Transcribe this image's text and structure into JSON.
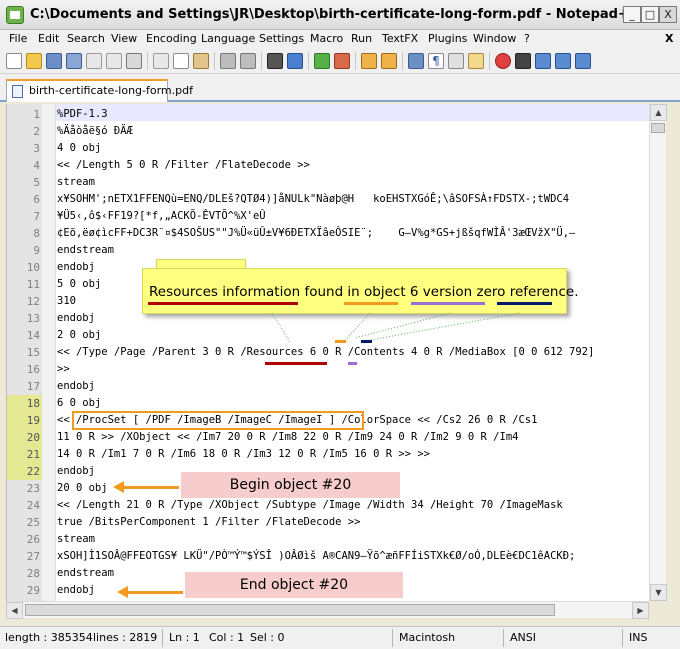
{
  "window": {
    "title": "C:\\Documents and Settings\\JR\\Desktop\\birth-certificate-long-form.pdf - Notepad++",
    "minimize": "_",
    "maximize": "□",
    "close": "X"
  },
  "menu": [
    "File",
    "Edit",
    "Search",
    "View",
    "Encoding",
    "Language",
    "Settings",
    "Macro",
    "Run",
    "TextFX",
    "Plugins",
    "Window",
    "?"
  ],
  "menu_close": "X",
  "tab": {
    "label": "birth-certificate-long-form.pdf"
  },
  "lines": [
    {
      "n": "1",
      "t": "%PDF-1.3"
    },
    {
      "n": "2",
      "t": "%Äåòåë§ó ÐÄÆ"
    },
    {
      "n": "3",
      "t": "4 0 obj"
    },
    {
      "n": "4",
      "t": "<< /Length 5 0 R /Filter /FlateDecode >>"
    },
    {
      "n": "5",
      "t": "stream"
    },
    {
      "n": "6",
      "t": "x¥SOHM';nETX1FFENQù=ENQ/DLEš?QTØ4)]åNULk\"Nàøþ@H   koEHSTXGóÊ;\\âSOFSÀ↑FDSTX-;tWDC4"
    },
    {
      "n": "7",
      "t": "¥Ü5‹,ô$‹FF19?[*f,„ACKÕ-ÊVTÕ^%X'eÛ"
    },
    {
      "n": "8",
      "t": "¢Eõ,ëø¢ìcFF+DC3R¨¤$4SOŠUS\"\"J%Ü«üÛ±V¥6ÐETXÏâeÔSIE¨;    G—V%g*GS+jßšqfWÌÂ'3æŒVžX\"Ü,—"
    },
    {
      "n": "9",
      "t": "endstream"
    },
    {
      "n": "10",
      "t": "endobj"
    },
    {
      "n": "11",
      "t": "5 0 obj"
    },
    {
      "n": "12",
      "t": "310"
    },
    {
      "n": "13",
      "t": "endobj"
    },
    {
      "n": "14",
      "t": "2 0 obj"
    },
    {
      "n": "15",
      "t": "<< /Type /Page /Parent 3 0 R /Resources 6 0 R /Contents 4 0 R /MediaBox [0 0 612 792]"
    },
    {
      "n": "16",
      "t": ">>"
    },
    {
      "n": "17",
      "t": "endobj"
    },
    {
      "n": "18",
      "t": "6 0 obj"
    },
    {
      "n": "19",
      "t": "<< /ProcSet [ /PDF /ImageB /ImageC /ImageI ] /ColorSpace << /Cs2 26 0 R /Cs1"
    },
    {
      "n": "20",
      "t": "11 0 R >> /XObject << /Im7 20 0 R /Im8 22 0 R /Im9 24 0 R /Im2 9 0 R /Im4"
    },
    {
      "n": "21",
      "t": "14 0 R /Im1 7 0 R /Im6 18 0 R /Im3 12 0 R /Im5 16 0 R >> >>"
    },
    {
      "n": "22",
      "t": "endobj"
    },
    {
      "n": "23",
      "t": "20 0 obj"
    },
    {
      "n": "24",
      "t": "<< /Length 21 0 R /Type /XObject /Subtype /Image /Width 34 /Height 70 /ImageMask"
    },
    {
      "n": "25",
      "t": "true /BitsPerComponent 1 /Filter /FlateDecode >>"
    },
    {
      "n": "26",
      "t": "stream"
    },
    {
      "n": "27",
      "t": "xSOH]Ì1SOÂ@FFEOTGS¥ LKÜ\"/PÒ™Ý™$ÝSÎ )OÂØìš A®CAN9—Ÿõ^æñFFÍiSTXk€Ø/oÓ,DLEè€DC1êACKÐ;"
    },
    {
      "n": "28",
      "t": "endstream"
    },
    {
      "n": "29",
      "t": "endobj"
    }
  ],
  "annotations": {
    "callout": "Resources information found in object 6 version zero reference.",
    "begin": "Begin object #20",
    "end": "End object #20"
  },
  "status": {
    "length": "length : 385354",
    "lines": "lines : 2819",
    "ln": "Ln : 1",
    "col": "Col : 1",
    "sel": "Sel : 0",
    "eol": "Macintosh",
    "encoding": "ANSI",
    "mode": "INS"
  },
  "colors": {
    "callout_bg": "#ffff80",
    "label_bg": "#f7cccc",
    "arrow": "#f29a1f",
    "underline_red": "#b00000",
    "underline_orange": "#f29a1f",
    "underline_purple": "#9b6fd1",
    "underline_navy": "#001a66",
    "highlight_green": "#66ee88"
  }
}
